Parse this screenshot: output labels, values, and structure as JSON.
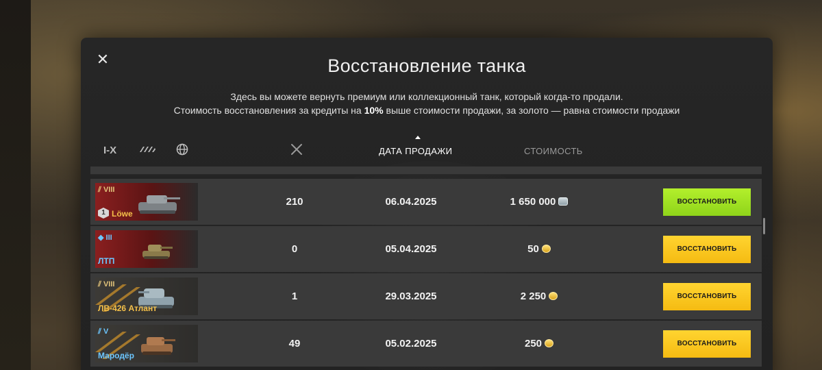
{
  "modal": {
    "close_symbol": "✕",
    "title": "Восстановление танка",
    "subtitle_line1": "Здесь вы можете вернуть премиум или коллекционный танк, который когда-то продали.",
    "subtitle_line2_a": "Стоимость восстановления за кредиты на ",
    "subtitle_line2_b": "10%",
    "subtitle_line2_c": " выше стоимости продажи, за золото — равна стоимости продажи"
  },
  "filters": {
    "tier_label": "I-X",
    "type_icon": "vehicle-class-icon",
    "nation_icon": "globe-icon"
  },
  "columns": {
    "battles_icon": "crossed-swords-icon",
    "date": "ДАТА ПРОДАЖИ",
    "price": "СТОИМОСТЬ",
    "sort_active": "date",
    "sort_color": "#ffffff",
    "inactive_color": "#9a9a9a"
  },
  "rows": [
    {
      "tier": "VIII",
      "tier_color": "#e0c27a",
      "name": "Löwe",
      "name_color": "#f4c04a",
      "mastery": "1",
      "banner": "#7a1a1a",
      "battles": "210",
      "date": "06.04.2025",
      "price": "1 650 000",
      "currency": "silver",
      "button": "ВОССТАНОВИТЬ",
      "button_style": "green"
    },
    {
      "tier": "III",
      "tier_color": "#6cc6ff",
      "name": "ЛТП",
      "name_color": "#6cc6ff",
      "mastery": "",
      "banner": "#7a1a1a",
      "battles": "0",
      "date": "05.04.2025",
      "price": "50",
      "currency": "gold",
      "button": "ВОССТАНОВИТЬ",
      "button_style": "yellow"
    },
    {
      "tier": "VIII",
      "tier_color": "#e0c27a",
      "name": "ЛВ-426 Атлант",
      "name_color": "#f4c04a",
      "mastery": "",
      "banner": "#3a3a3a",
      "battles": "1",
      "date": "29.03.2025",
      "price": "2 250",
      "currency": "gold",
      "button": "ВОССТАНОВИТЬ",
      "button_style": "yellow"
    },
    {
      "tier": "V",
      "tier_color": "#6cc6ff",
      "name": "Мародёр",
      "name_color": "#6cc6ff",
      "mastery": "",
      "banner": "#3a3a3a",
      "battles": "49",
      "date": "05.02.2025",
      "price": "250",
      "currency": "gold",
      "button": "ВОССТАНОВИТЬ",
      "button_style": "yellow"
    }
  ]
}
